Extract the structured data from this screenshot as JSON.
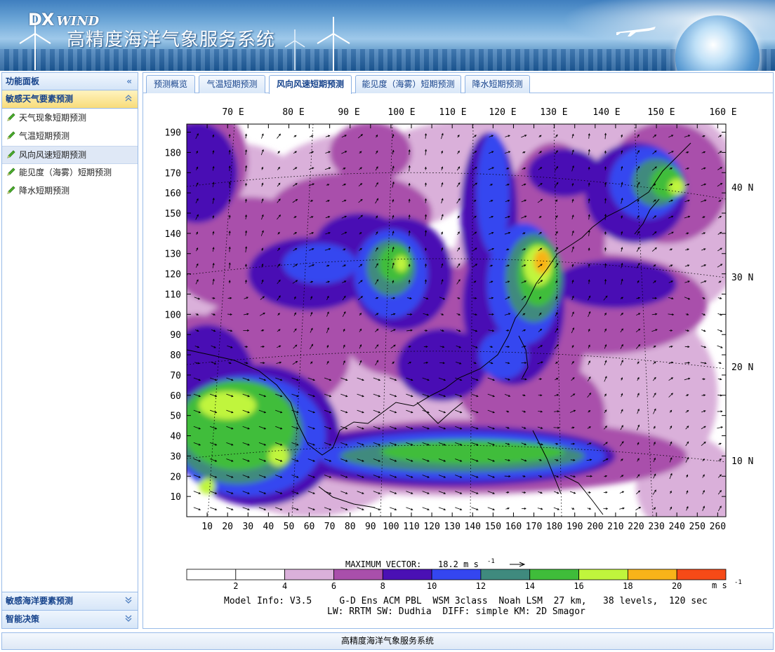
{
  "header": {
    "logo_prefix": "DX",
    "logo_word": "WIND",
    "title": "高精度海洋气象服务系统"
  },
  "sidebar": {
    "panel_title": "功能面板",
    "panel_chevron": "«",
    "sections": [
      {
        "title": "敏感天气要素预测",
        "state": "expanded",
        "items": [
          {
            "label": "天气现象短期预测",
            "icon": "pencil-icon"
          },
          {
            "label": "气温短期预测",
            "icon": "pencil-icon"
          },
          {
            "label": "风向风速短期预测",
            "icon": "pencil-icon",
            "selected": true
          },
          {
            "label": "能见度（海雾）短期预测",
            "icon": "pencil-icon"
          },
          {
            "label": "降水短期预测",
            "icon": "pencil-icon"
          }
        ]
      },
      {
        "title": "敏感海洋要素预测",
        "state": "collapsed"
      },
      {
        "title": "智能决策",
        "state": "collapsed"
      }
    ]
  },
  "tabs": [
    {
      "label": "预测概览"
    },
    {
      "label": "气温短期预测"
    },
    {
      "label": "风向风速短期预测",
      "active": true
    },
    {
      "label": "能见度（海雾）短期预测"
    },
    {
      "label": "降水短期预测"
    }
  ],
  "chart_data": {
    "type": "heatmap",
    "x_ticks": [
      10,
      20,
      30,
      40,
      50,
      60,
      70,
      80,
      90,
      100,
      110,
      120,
      130,
      140,
      150,
      160,
      170,
      180,
      190,
      200,
      210,
      220,
      230,
      240,
      250,
      260
    ],
    "y_ticks": [
      10,
      20,
      30,
      40,
      50,
      60,
      70,
      80,
      90,
      100,
      110,
      120,
      130,
      140,
      150,
      160,
      170,
      180,
      190
    ],
    "xlim": [
      0,
      264
    ],
    "ylim": [
      0,
      194
    ],
    "longitude_labels": [
      "70 E",
      "80 E",
      "90 E",
      "100 E",
      "110 E",
      "120 E",
      "130 E",
      "140 E",
      "150 E",
      "160 E"
    ],
    "latitude_labels": [
      "40 N",
      "30 N",
      "20 N",
      "10 N"
    ],
    "colorbar": {
      "ticks": [
        "2",
        "4",
        "6",
        "8",
        "10",
        "12",
        "14",
        "16",
        "18",
        "20"
      ],
      "unit_base": "m s",
      "unit_exp": "-1",
      "colors": [
        "#ffffff",
        "#ffffff",
        "#dab0da",
        "#a94fab",
        "#4a10b4",
        "#3446f0",
        "#3f8a7e",
        "#3fbd3a",
        "#c0f53c",
        "#f8b319",
        "#f64a17"
      ]
    },
    "max_vector_label": "MAXIMUM VECTOR:",
    "max_vector_value": "18.2 m s",
    "max_vector_exp": "-1",
    "model_info_line1": "Model Info: V3.5     G-D Ens ACM PBL  WSM 3class  Noah LSM  27 km,   38 levels,  120 sec",
    "model_info_line2": "LW: RRTM SW: Dudhia  DIFF: simple KM: 2D Smagor"
  },
  "footer": {
    "text": "高精度海洋气象服务系统"
  }
}
